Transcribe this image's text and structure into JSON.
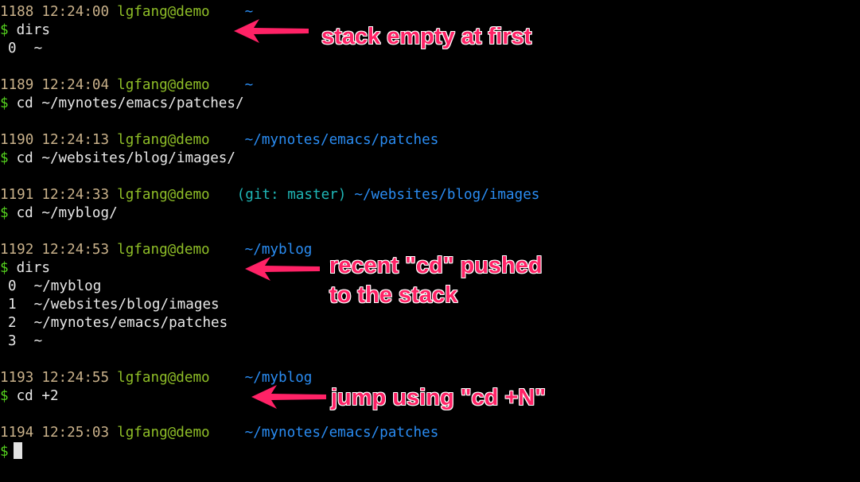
{
  "colors": {
    "background": "#000000",
    "history_number": "#c9b18a",
    "timestamp": "#c9b18a",
    "user_host": "#8ebd27",
    "path": "#2a8cf2",
    "git": "#1fb6b6",
    "dollar": "#55d21e",
    "text": "#e8e8e8",
    "annotation": "#ff2266",
    "cursor": "#e3e3e3"
  },
  "blocks": [
    {
      "prompt": {
        "num": "1188",
        "time": "12:24:00",
        "user": "lgfang@demo",
        "git": "",
        "path": "~"
      },
      "dollar": "$",
      "command": "dirs",
      "output": [
        {
          "index": "0",
          "path": "~"
        }
      ]
    },
    {
      "prompt": {
        "num": "1189",
        "time": "12:24:04",
        "user": "lgfang@demo",
        "git": "",
        "path": "~"
      },
      "dollar": "$",
      "command": "cd ~/mynotes/emacs/patches/",
      "output": []
    },
    {
      "prompt": {
        "num": "1190",
        "time": "12:24:13",
        "user": "lgfang@demo",
        "git": "",
        "path": "~/mynotes/emacs/patches"
      },
      "dollar": "$",
      "command": "cd ~/websites/blog/images/",
      "output": []
    },
    {
      "prompt": {
        "num": "1191",
        "time": "12:24:33",
        "user": "lgfang@demo",
        "git": "(git: master)",
        "path": "~/websites/blog/images"
      },
      "dollar": "$",
      "command": "cd ~/myblog/",
      "output": []
    },
    {
      "prompt": {
        "num": "1192",
        "time": "12:24:53",
        "user": "lgfang@demo",
        "git": "",
        "path": "~/myblog"
      },
      "dollar": "$",
      "command": "dirs",
      "output": [
        {
          "index": "0",
          "path": "~/myblog"
        },
        {
          "index": "1",
          "path": "~/websites/blog/images"
        },
        {
          "index": "2",
          "path": "~/mynotes/emacs/patches"
        },
        {
          "index": "3",
          "path": "~"
        }
      ]
    },
    {
      "prompt": {
        "num": "1193",
        "time": "12:24:55",
        "user": "lgfang@demo",
        "git": "",
        "path": "~/myblog"
      },
      "dollar": "$",
      "command": "cd +2",
      "output": []
    },
    {
      "prompt": {
        "num": "1194",
        "time": "12:25:03",
        "user": "lgfang@demo",
        "git": "",
        "path": "~/mynotes/emacs/patches"
      },
      "dollar": "$",
      "command": "",
      "output": [],
      "cursor": true
    }
  ],
  "annotations": [
    {
      "lines": [
        "stack empty at first"
      ]
    },
    {
      "lines": [
        "recent \"cd\" pushed",
        "to the stack"
      ]
    },
    {
      "lines": [
        "jump using \"cd +N\""
      ]
    }
  ]
}
